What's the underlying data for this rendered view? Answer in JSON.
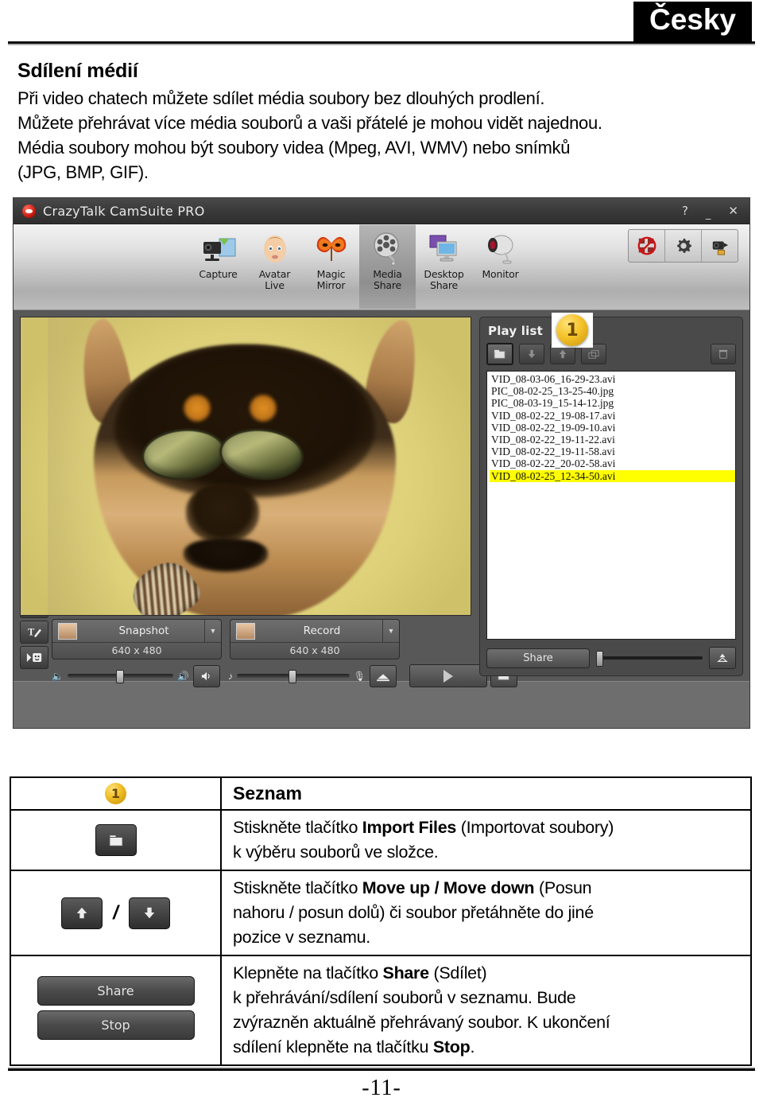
{
  "header": {
    "language_badge": "Česky"
  },
  "intro": {
    "title": "Sdílení médií",
    "line1": "Při video chatech můžete sdílet média soubory bez dlouhých prodlení.",
    "line2": "Můžete přehrávat více média souborů a vaši přátelé je mohou vidět najednou.",
    "line3": "Média soubory mohou být soubory videa (Mpeg, AVI, WMV) nebo snímků",
    "line4": "(JPG, BMP, GIF)."
  },
  "app": {
    "title": "CrazyTalk CamSuite PRO",
    "window_controls": {
      "help": "?",
      "minimize": "_",
      "close": "✕"
    },
    "toolbar": [
      {
        "label_line1": "Capture",
        "label_line2": "",
        "icon": "camcorder-photo-icon",
        "active": false
      },
      {
        "label_line1": "Avatar",
        "label_line2": "Live",
        "icon": "baby-face-icon",
        "active": false
      },
      {
        "label_line1": "Magic",
        "label_line2": "Mirror",
        "icon": "carnival-mask-icon",
        "active": false
      },
      {
        "label_line1": "Media",
        "label_line2": "Share",
        "icon": "film-reel-icon",
        "active": true
      },
      {
        "label_line1": "Desktop",
        "label_line2": "Share",
        "icon": "monitor-screens-icon",
        "active": false
      },
      {
        "label_line1": "Monitor",
        "label_line2": "",
        "icon": "webcam-icon",
        "active": false
      }
    ],
    "right_tools": [
      {
        "icon": "disable-emoticon-icon"
      },
      {
        "icon": "gear-icon"
      },
      {
        "icon": "camera-settings-icon"
      }
    ],
    "vertical_tools": [
      {
        "icon": "video-frame-icon"
      },
      {
        "icon": "text-tool-icon"
      },
      {
        "icon": "emoticon-tool-icon"
      }
    ],
    "snapshot": {
      "label": "Snapshot",
      "resolution": "640 x 480",
      "arrow": "▼"
    },
    "record": {
      "label": "Record",
      "resolution": "640 x 480",
      "arrow": "▼"
    },
    "sliders": {
      "speaker_left_icon": "speaker-low-icon",
      "speaker_right_icon": "speaker-high-icon",
      "speaker_button_icon": "speaker-icon",
      "mic_left_icon": "music-note-icon",
      "mic_right_icon": "microphone-icon",
      "mic_button_icon": "mic-mixer-icon"
    },
    "playback": {
      "play_icon": "play-icon",
      "folder_icon": "folder-icon"
    },
    "playlist": {
      "title": "Play list",
      "buttons": [
        {
          "icon": "folder-import-icon",
          "selected": true,
          "dim": false
        },
        {
          "icon": "arrow-down-icon",
          "selected": false,
          "dim": true
        },
        {
          "icon": "arrow-up-icon",
          "selected": false,
          "dim": true
        },
        {
          "icon": "duplicate-icon",
          "selected": false,
          "dim": true
        },
        {
          "icon": "trash-icon",
          "selected": false,
          "dim": true
        }
      ],
      "items": [
        {
          "name": "VID_08-03-06_16-29-23.avi",
          "highlighted": false
        },
        {
          "name": "PIC_08-02-25_13-25-40.jpg",
          "highlighted": false
        },
        {
          "name": "PIC_08-03-19_15-14-12.jpg",
          "highlighted": false
        },
        {
          "name": "VID_08-02-22_19-08-17.avi",
          "highlighted": false
        },
        {
          "name": "VID_08-02-22_19-09-10.avi",
          "highlighted": false
        },
        {
          "name": "VID_08-02-22_19-11-22.avi",
          "highlighted": false
        },
        {
          "name": "VID_08-02-22_19-11-58.avi",
          "highlighted": false
        },
        {
          "name": "VID_08-02-22_20-02-58.avi",
          "highlighted": false
        },
        {
          "name": "VID_08-02-25_12-34-50.avi",
          "highlighted": true
        }
      ],
      "share_button": "Share",
      "fullscreen_icon": "fullscreen-icon",
      "callout_badge": "1"
    }
  },
  "legend": {
    "rows": [
      {
        "badge": "1",
        "icon_type": "badge",
        "heading": "Seznam",
        "text_html": ""
      },
      {
        "icon_type": "folder-button",
        "icon_glyph": "▣",
        "line1_pre": "Stiskněte tlačítko ",
        "line1_bold": "Import Files",
        "line1_post": " (Importovat soubory)",
        "line2": "k výběru souborů ve složce."
      },
      {
        "icon_type": "arrow-buttons",
        "up_glyph": "⬆",
        "down_glyph": "⬇",
        "separator": "/",
        "line1_pre": "Stiskněte tlačítko ",
        "line1_bold": "Move up / Move down",
        "line1_post": " (Posun",
        "line2": "nahoru / posun dolů) či soubor přetáhněte do jiné",
        "line3": "pozice v seznamu."
      },
      {
        "icon_type": "share-stop-buttons",
        "share_label": "Share",
        "stop_label": "Stop",
        "line1_pre": "Klepněte na tlačítko ",
        "line1_bold": "Share",
        "line1_post": " (Sdílet)",
        "line2": "k přehrávání/sdílení souborů v seznamu. Bude",
        "line3": "zvýrazněn aktuálně přehrávaný soubor. K ukončení",
        "line4_pre": "sdílení klepněte na tlačítku ",
        "line4_bold": "Stop",
        "line4_post": "."
      }
    ]
  },
  "footer": {
    "page_number": "-11-"
  }
}
